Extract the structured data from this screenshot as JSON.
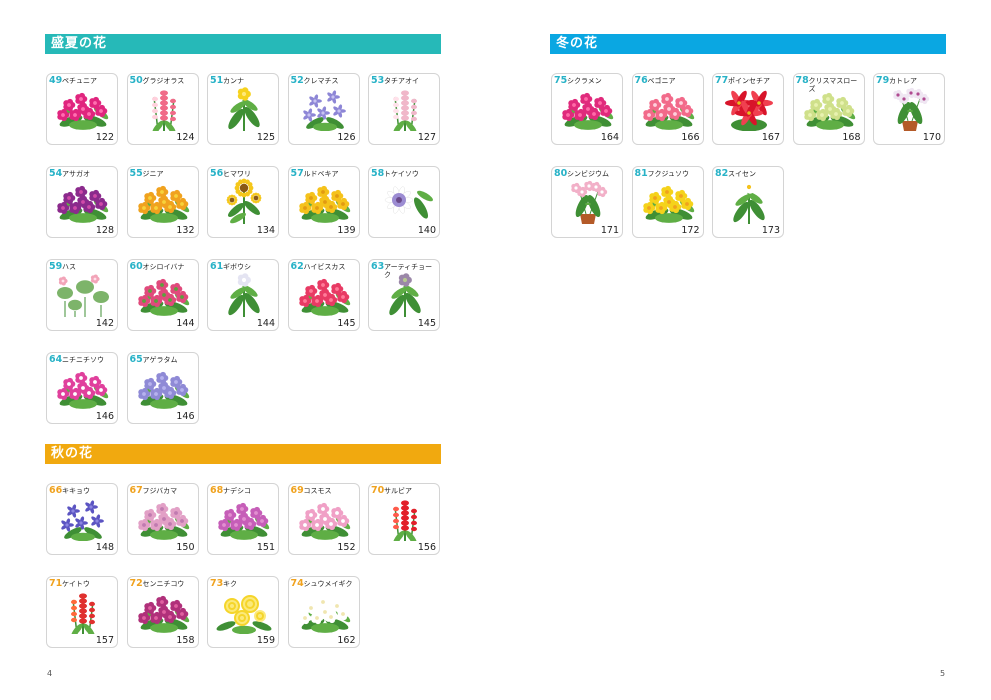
{
  "sections": [
    {
      "id": "summer",
      "title": "盛夏の花",
      "color": "#26b9b8",
      "num_color": "#27b2c7",
      "items": [
        {
          "num": "49",
          "name": "ペチュニア",
          "page": "122",
          "kind": "petunia",
          "c1": "#e0257e",
          "c2": "#ff6fb0"
        },
        {
          "num": "50",
          "name": "グラジオラス",
          "page": "124",
          "kind": "spike",
          "c1": "#f06b88",
          "c2": "#ffd0dc"
        },
        {
          "num": "51",
          "name": "カンナ",
          "page": "125",
          "kind": "tall",
          "c1": "#f6d21e",
          "c2": "#ffe97a"
        },
        {
          "num": "52",
          "name": "クレマチス",
          "page": "126",
          "kind": "star",
          "c1": "#8d86d6",
          "c2": "#c8c3f2"
        },
        {
          "num": "53",
          "name": "タチアオイ",
          "page": "127",
          "kind": "spike",
          "c1": "#f0b7c9",
          "c2": "#ffe1ea"
        },
        {
          "num": "54",
          "name": "アサガオ",
          "page": "128",
          "kind": "bush",
          "c1": "#8b2a8c",
          "c2": "#d04aa8"
        },
        {
          "num": "55",
          "name": "ジニア",
          "page": "132",
          "kind": "bush",
          "c1": "#f0a21e",
          "c2": "#f7d23a"
        },
        {
          "num": "56",
          "name": "ヒマワリ",
          "page": "134",
          "kind": "sunflower",
          "c1": "#f5c71b",
          "c2": "#8a5a15"
        },
        {
          "num": "57",
          "name": "ルドベキア",
          "page": "139",
          "kind": "bush",
          "c1": "#f5c21b",
          "c2": "#e29b12"
        },
        {
          "num": "58",
          "name": "トケイソウ",
          "page": "140",
          "kind": "passion",
          "c1": "#9c8cd2",
          "c2": "#ffffff"
        },
        {
          "num": "59",
          "name": "ハス",
          "page": "142",
          "kind": "lotus",
          "c1": "#f2a4b8",
          "c2": "#7db46a"
        },
        {
          "num": "60",
          "name": "オシロイバナ",
          "page": "144",
          "kind": "bush",
          "c1": "#e04a7c",
          "c2": "#5aa23e"
        },
        {
          "num": "61",
          "name": "ギボウシ",
          "page": "144",
          "kind": "tall",
          "c1": "#e4e4f2",
          "c2": "#ffffff"
        },
        {
          "num": "62",
          "name": "ハイビスカス",
          "page": "145",
          "kind": "bush",
          "c1": "#e83a64",
          "c2": "#ff7a98"
        },
        {
          "num": "63",
          "name": "アーティチョーク",
          "page": "145",
          "kind": "tall",
          "c1": "#9b87a8",
          "c2": "#b7c890"
        },
        {
          "num": "64",
          "name": "ニチニチソウ",
          "page": "146",
          "kind": "bush",
          "c1": "#e0409c",
          "c2": "#ffffff"
        },
        {
          "num": "65",
          "name": "アゲラタム",
          "page": "146",
          "kind": "bush",
          "c1": "#8f8ad6",
          "c2": "#b6b2ee"
        }
      ]
    },
    {
      "id": "autumn",
      "title": "秋の花",
      "color": "#f1a90f",
      "num_color": "#f0a21e",
      "items": [
        {
          "num": "66",
          "name": "キキョウ",
          "page": "148",
          "kind": "star",
          "c1": "#5b54c2",
          "c2": "#8c86e2"
        },
        {
          "num": "67",
          "name": "フジバカマ",
          "page": "150",
          "kind": "bush",
          "c1": "#e2a0c6",
          "c2": "#c07ab0"
        },
        {
          "num": "68",
          "name": "ナデシコ",
          "page": "151",
          "kind": "bush",
          "c1": "#c65eb8",
          "c2": "#e28fd0"
        },
        {
          "num": "69",
          "name": "コスモス",
          "page": "152",
          "kind": "bush",
          "c1": "#f0a0c6",
          "c2": "#ffffff"
        },
        {
          "num": "70",
          "name": "サルビア",
          "page": "156",
          "kind": "spike",
          "c1": "#e2202a",
          "c2": "#ff5a4a"
        },
        {
          "num": "71",
          "name": "ケイトウ",
          "page": "157",
          "kind": "spike",
          "c1": "#e0302e",
          "c2": "#ff6a3a"
        },
        {
          "num": "72",
          "name": "センニチコウ",
          "page": "158",
          "kind": "bush",
          "c1": "#b0307a",
          "c2": "#e060a0"
        },
        {
          "num": "73",
          "name": "キク",
          "page": "159",
          "kind": "mum",
          "c1": "#f5d52a",
          "c2": "#fbe97a"
        },
        {
          "num": "74",
          "name": "シュウメイギク",
          "page": "162",
          "kind": "bush",
          "c1": "#ffffff",
          "c2": "#f0e6b0"
        }
      ]
    },
    {
      "id": "winter",
      "title": "冬の花",
      "color": "#0aa7e2",
      "num_color": "#27b2c7",
      "items": [
        {
          "num": "75",
          "name": "シクラメン",
          "page": "164",
          "kind": "bush",
          "c1": "#e02a7c",
          "c2": "#ff6aa8"
        },
        {
          "num": "76",
          "name": "ベゴニア",
          "page": "166",
          "kind": "bush",
          "c1": "#f26a8a",
          "c2": "#ffd0dc"
        },
        {
          "num": "77",
          "name": "ポインセチア",
          "page": "167",
          "kind": "poinsettia",
          "c1": "#d8142a",
          "c2": "#f04050"
        },
        {
          "num": "78",
          "name": "クリスマスローズ",
          "page": "168",
          "kind": "bush",
          "c1": "#cfe08a",
          "c2": "#e8f2b0"
        },
        {
          "num": "79",
          "name": "カトレア",
          "page": "170",
          "kind": "pot",
          "c1": "#efe6f2",
          "c2": "#b04a90"
        },
        {
          "num": "80",
          "name": "シンビジウム",
          "page": "171",
          "kind": "pot",
          "c1": "#f2b0c8",
          "c2": "#ffffff"
        },
        {
          "num": "81",
          "name": "フクジュソウ",
          "page": "172",
          "kind": "bush",
          "c1": "#f5d21b",
          "c2": "#f0a21e"
        },
        {
          "num": "82",
          "name": "スイセン",
          "page": "173",
          "kind": "tall",
          "c1": "#ffffff",
          "c2": "#f5c21b"
        }
      ]
    }
  ],
  "page_numbers": {
    "left": "4",
    "right": "5"
  }
}
